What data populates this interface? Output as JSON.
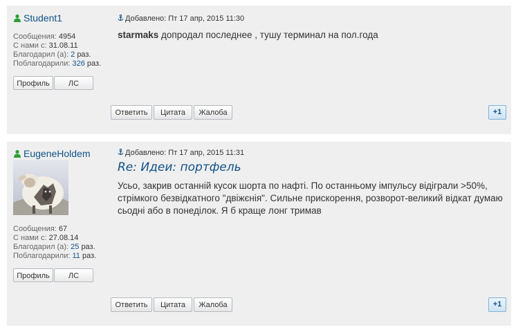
{
  "posts": [
    {
      "author": "Student1",
      "stats": {
        "messages_label": "Сообщения:",
        "messages": "4954",
        "joined_label": "С нами с:",
        "joined": "31.08.11",
        "thanked_label": "Благодарил (а):",
        "thanked": "2",
        "thanked_suffix": "раз.",
        "thanks_label": "Поблагодарили:",
        "thanks": "326",
        "thanks_suffix": "раз."
      },
      "profile_label": "Профиль",
      "pm_label": "ЛС",
      "meta": "Добавлено: Пт 17 апр, 2015 11:30",
      "title": "",
      "quote_author": "starmaks",
      "content": " допродал последнее , тушу терминал на пол.года",
      "reply_label": "Ответить",
      "quote_label": "Цитата",
      "report_label": "Жалоба",
      "plus_label": "+1"
    },
    {
      "author": "EugeneHoldem",
      "avatar": "sheep-wolf-avatar",
      "stats": {
        "messages_label": "Сообщения:",
        "messages": "67",
        "joined_label": "С нами с:",
        "joined": "27.08.14",
        "thanked_label": "Благодарил (а):",
        "thanked": "25",
        "thanked_suffix": "раз.",
        "thanks_label": "Поблагодарили:",
        "thanks": "11",
        "thanks_suffix": "раз."
      },
      "profile_label": "Профиль",
      "pm_label": "ЛС",
      "meta": "Добавлено: Пт 17 апр, 2015 11:31",
      "title": "Re: Идеи: портфель",
      "content": "Усьо, закрив останній кусок шорта по нафті. По останньому імпульсу відіграли >50%, стрімкого безвідкатного \"двіжєнія\". Сильне прискорення, розворот-великий відкат думаю сьодні або в понеділок. Я б краще лонг тримав",
      "reply_label": "Ответить",
      "quote_label": "Цитата",
      "report_label": "Жалоба",
      "plus_label": "+1"
    }
  ],
  "colors": {
    "link": "#105289",
    "post_bg": "#efefef",
    "online": "#2e9e3a"
  }
}
